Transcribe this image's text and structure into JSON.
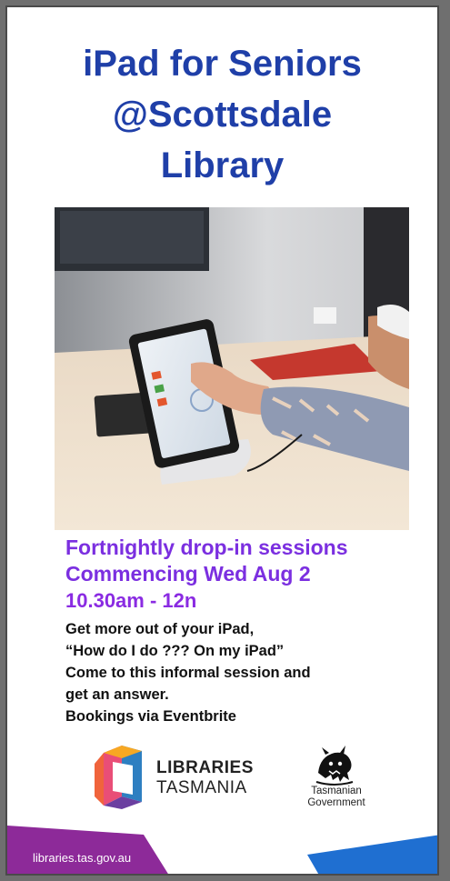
{
  "title": {
    "line1": "iPad for Seniors",
    "line2": "@Scottsdale",
    "line3": "Library"
  },
  "sessions": {
    "line1": "Fortnightly drop-in sessions",
    "line2": "Commencing Wed Aug 2",
    "time": "10.30am - 12n"
  },
  "details": {
    "line1": "Get more out of your iPad,",
    "line2": "“How do I do ??? On my iPad”",
    "line3": "Come  to this informal session and",
    "line4": "get an answer.",
    "line5": "Bookings via Eventbrite"
  },
  "logos": {
    "libraries_line1": "LIBRARIES",
    "libraries_line2": "TASMANIA",
    "gov_line1": "Tasmanian",
    "gov_line2": "Government"
  },
  "footer": {
    "url": "libraries.tas.gov.au"
  },
  "colors": {
    "title": "#1f3fa8",
    "sessions": "#7b2fe0",
    "footer_purple": "#8d2a99",
    "footer_blue": "#1f6fd1"
  }
}
